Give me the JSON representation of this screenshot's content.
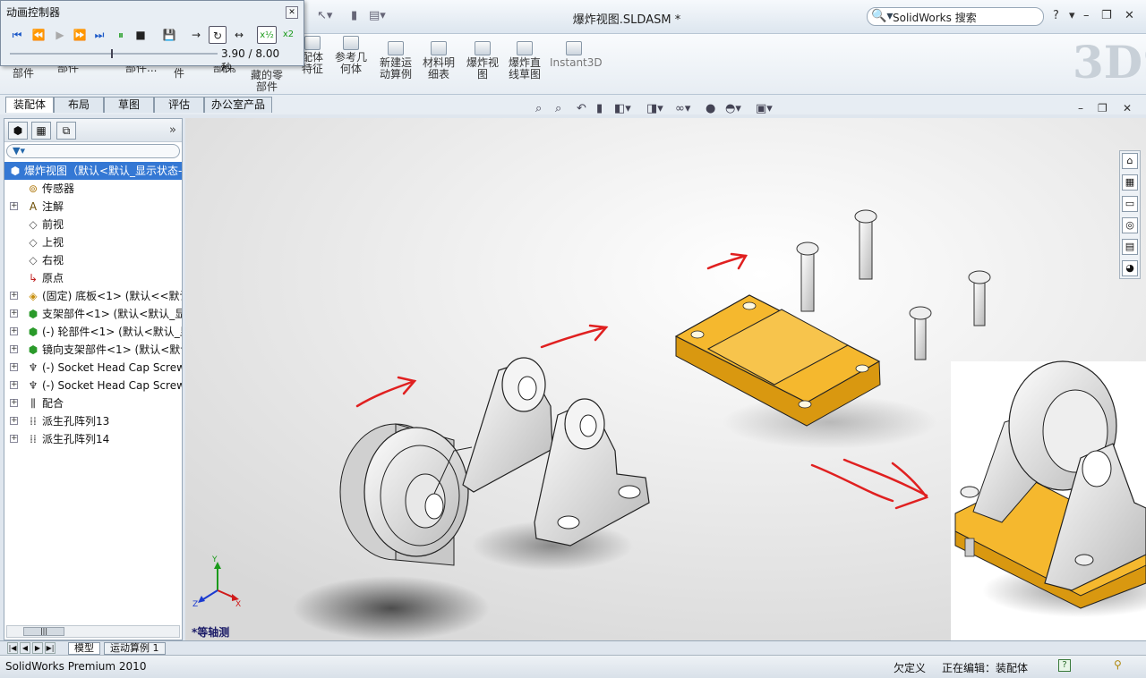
{
  "window": {
    "title": "爆炸视图.SLDASM *",
    "search_placeholder": "SolidWorks 搜索",
    "help": "?"
  },
  "animation_controller": {
    "title": "动画控制器",
    "time_display": "3.90 / 8.00 秒。",
    "progress": 0.4875,
    "speed_half": "x½",
    "speed_double": "x2"
  },
  "ribbon": {
    "partial_labels": [
      "部件",
      "部件",
      "部件...",
      "件",
      "部件"
    ],
    "buttons": [
      {
        "label": "藏的零部件"
      },
      {
        "label": "配体特征"
      },
      {
        "label": "参考几何体"
      },
      {
        "label": "新建运动算例"
      },
      {
        "label": "材料明细表"
      },
      {
        "label": "爆炸视图"
      },
      {
        "label": "爆炸直线草图"
      },
      {
        "label": "Instant3D"
      }
    ]
  },
  "command_tabs": [
    {
      "label": "装配体",
      "active": true
    },
    {
      "label": "布局",
      "active": false
    },
    {
      "label": "草图",
      "active": false
    },
    {
      "label": "评估",
      "active": false
    },
    {
      "label": "办公室产品",
      "active": false
    }
  ],
  "feature_tree": {
    "root": "爆炸视图（默认<默认_显示状态-",
    "items": [
      {
        "label": "传感器",
        "icon": "sensor-icon",
        "expandable": false
      },
      {
        "label": "注解",
        "icon": "annotation-icon",
        "expandable": true
      },
      {
        "label": "前视",
        "icon": "plane-icon",
        "expandable": false
      },
      {
        "label": "上视",
        "icon": "plane-icon",
        "expandable": false
      },
      {
        "label": "右视",
        "icon": "plane-icon",
        "expandable": false
      },
      {
        "label": "原点",
        "icon": "origin-icon",
        "expandable": false
      },
      {
        "label": "(固定) 底板<1> (默认<<默认",
        "icon": "part-icon",
        "expandable": true
      },
      {
        "label": "支架部件<1> (默认<默认_显",
        "icon": "subassembly-icon",
        "expandable": true
      },
      {
        "label": "(-) 轮部件<1> (默认<默认_显",
        "icon": "subassembly-icon",
        "expandable": true
      },
      {
        "label": "镜向支架部件<1> (默认<默认",
        "icon": "subassembly-icon",
        "expandable": true
      },
      {
        "label": "(-) Socket Head Cap Screw",
        "icon": "screw-icon",
        "expandable": true
      },
      {
        "label": "(-) Socket Head Cap Screw",
        "icon": "screw-icon",
        "expandable": true
      },
      {
        "label": "配合",
        "icon": "mates-icon",
        "expandable": true
      },
      {
        "label": "派生孔阵列13",
        "icon": "pattern-icon",
        "expandable": true
      },
      {
        "label": "派生孔阵列14",
        "icon": "pattern-icon",
        "expandable": true
      }
    ]
  },
  "viewport": {
    "view_name": "*等轴测"
  },
  "bottom_tabs": [
    {
      "label": "模型",
      "active": true
    },
    {
      "label": "运动算例 1",
      "active": false
    }
  ],
  "status_bar": {
    "app": "SolidWorks Premium 2010",
    "state": "欠定义",
    "editing": "正在编辑：装配体"
  },
  "colors": {
    "accent_selection": "#3478d4",
    "base_plate": "#f5b82e",
    "annotation_arrow": "#e02020"
  }
}
